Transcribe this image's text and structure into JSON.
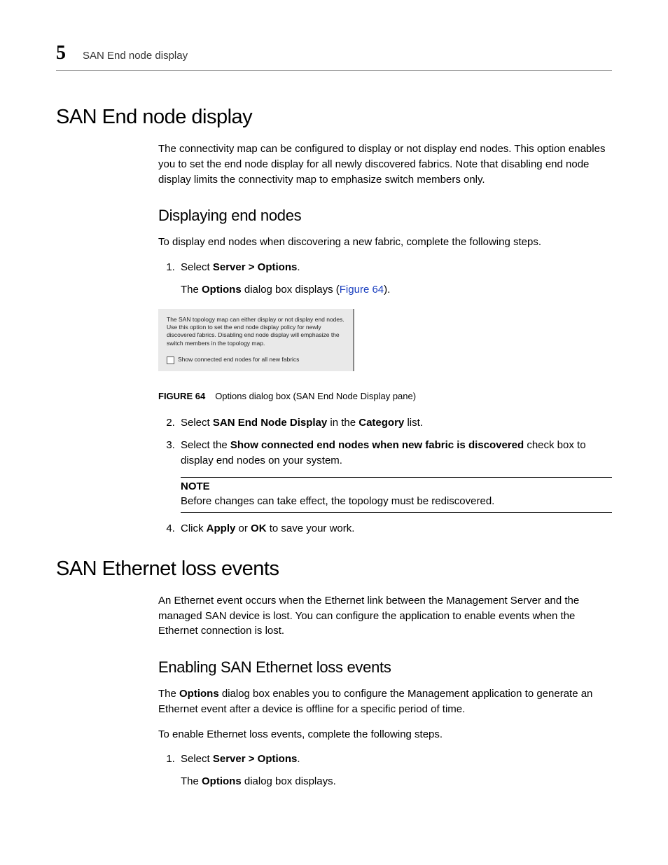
{
  "header": {
    "chapter_number": "5",
    "running_head": "SAN End node display"
  },
  "section1": {
    "title": "SAN End node display",
    "intro": "The connectivity map can be configured to display or not display end nodes. This option enables you to set the end node display for all newly discovered fabrics. Note that disabling end node display limits the connectivity map to emphasize switch members only.",
    "sub_title": "Displaying end nodes",
    "sub_intro": "To display end nodes when discovering a new fabric, complete the following steps.",
    "step1_pre": "Select ",
    "step1_bold": "Server > Options",
    "step1_post": ".",
    "step1_sub_pre": "The ",
    "step1_sub_bold": "Options",
    "step1_sub_mid": " dialog box displays (",
    "step1_sub_link": "Figure 64",
    "step1_sub_end": ").",
    "figure": {
      "panel_text": "The SAN topology map can either display or not display end nodes. Use this option to set the end node display policy for newly discovered fabrics. Disabling end node display will emphasize the switch members in the topology map.",
      "checkbox_label": "Show connected end nodes for all new fabrics"
    },
    "fig_caption_label": "FIGURE 64",
    "fig_caption_text": "Options dialog box (SAN End Node Display pane)",
    "step2_pre": "Select ",
    "step2_b1": "SAN End Node Display",
    "step2_mid": " in the ",
    "step2_b2": "Category",
    "step2_post": " list.",
    "step3_pre": "Select the ",
    "step3_b1": "Show connected end nodes when new fabric is discovered",
    "step3_post": " check box to display end nodes on your system.",
    "note_label": "NOTE",
    "note_body": "Before changes can take effect, the topology must be rediscovered.",
    "step4_pre": "Click ",
    "step4_b1": "Apply",
    "step4_mid": " or ",
    "step4_b2": "OK",
    "step4_post": " to save your work."
  },
  "section2": {
    "title": "SAN Ethernet loss events",
    "intro": "An Ethernet event occurs when the Ethernet link between the Management Server and the managed SAN device is lost. You can configure the application to enable events when the Ethernet connection is lost.",
    "sub_title": "Enabling SAN Ethernet loss events",
    "sub_intro_pre": "The ",
    "sub_intro_bold": "Options",
    "sub_intro_post": " dialog box enables you to configure the Management application to generate an Ethernet event after a device is offline for a specific period of time.",
    "sub_lead": "To enable Ethernet loss events, complete the following steps.",
    "step1_pre": "Select ",
    "step1_bold": "Server > Options",
    "step1_post": ".",
    "step1_sub_pre": "The ",
    "step1_sub_bold": "Options",
    "step1_sub_post": " dialog box displays."
  }
}
